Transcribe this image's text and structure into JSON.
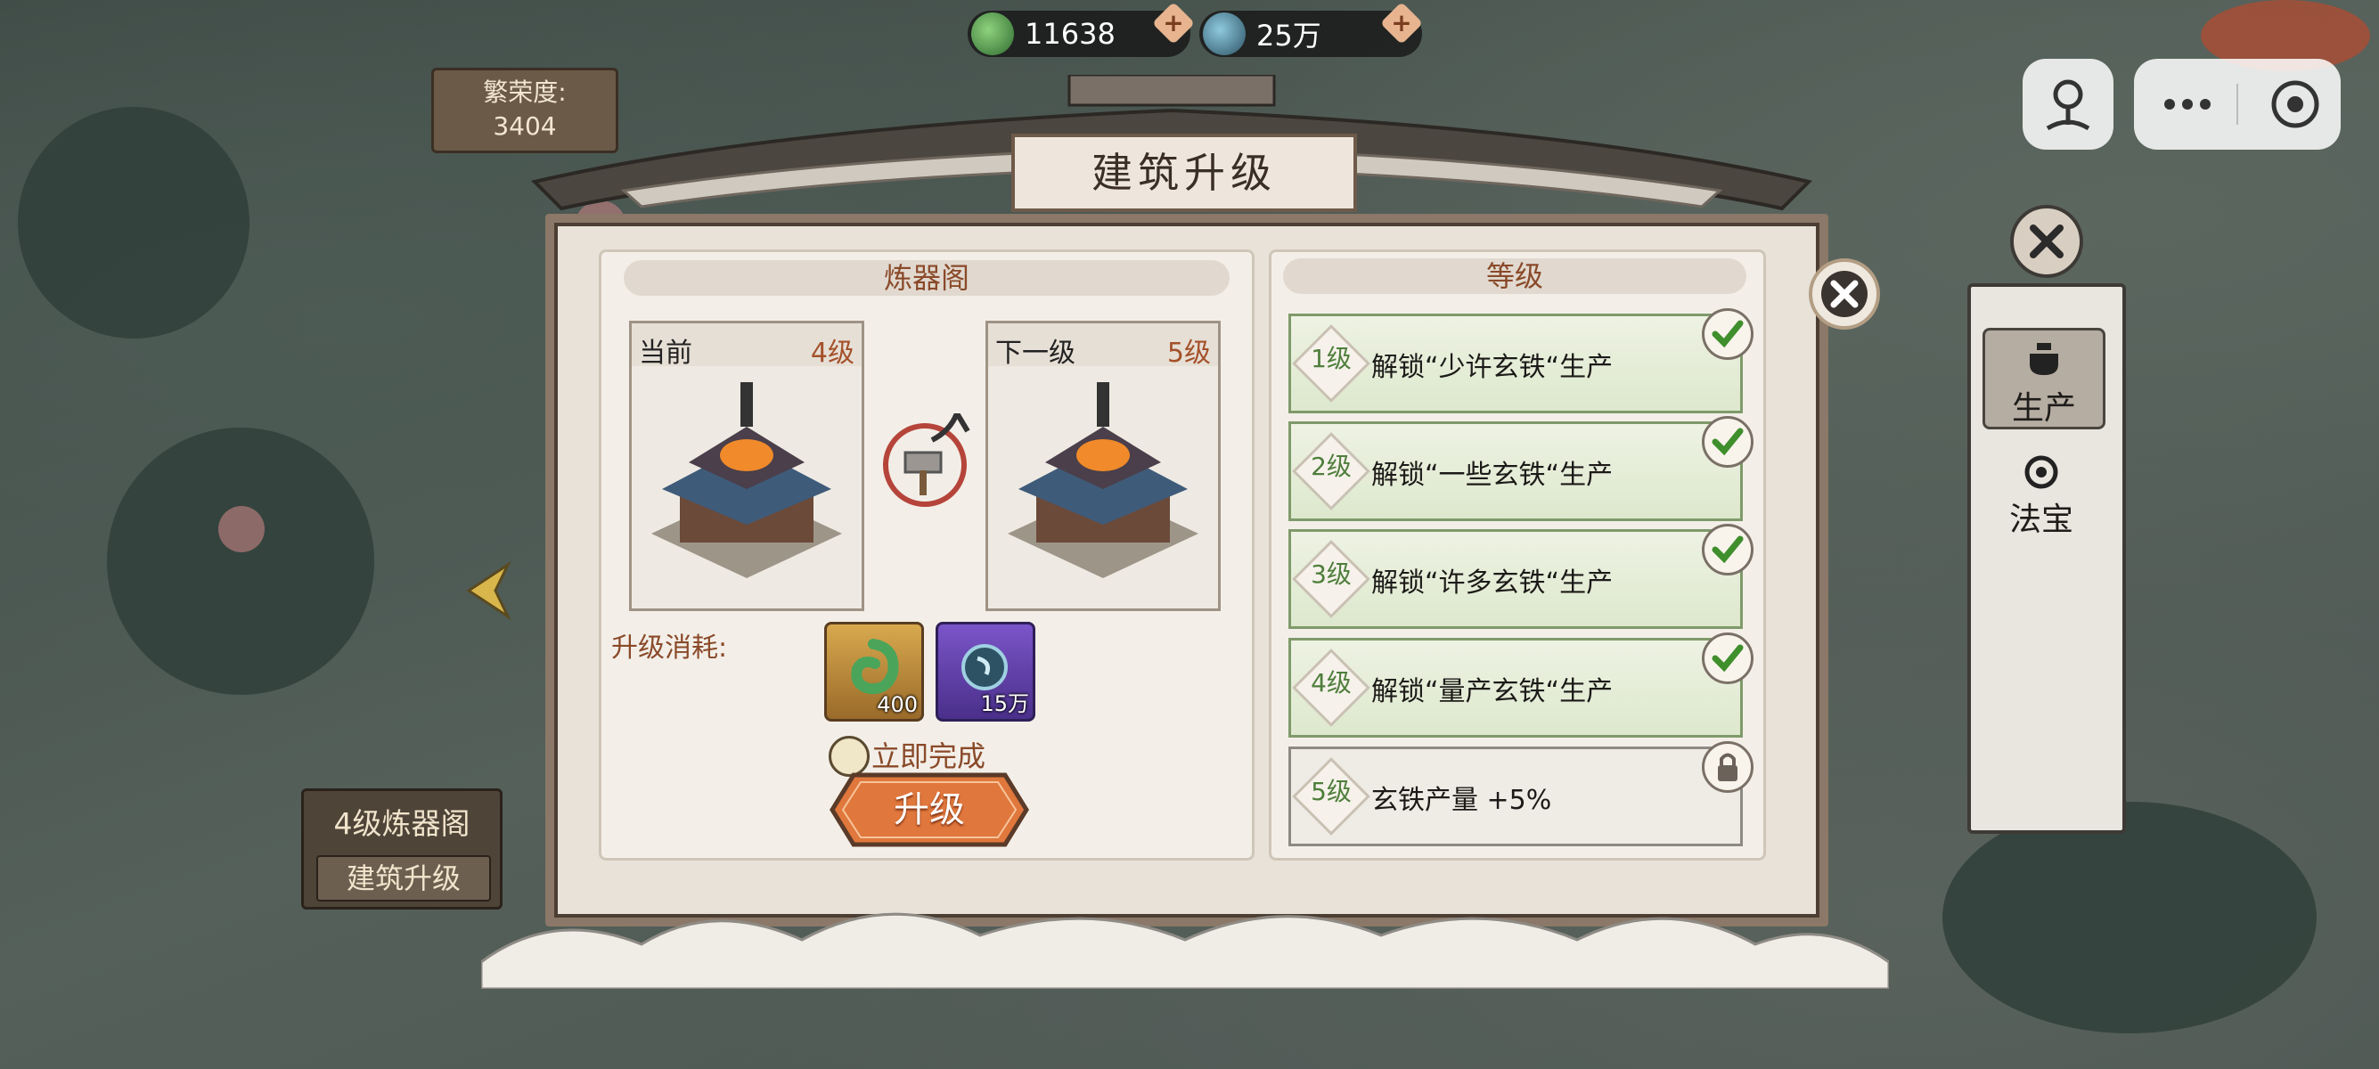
{
  "currency": {
    "jade": {
      "icon": "jade-icon",
      "amount": "11638"
    },
    "iron": {
      "icon": "iron-orb-icon",
      "amount": "25万"
    }
  },
  "prosperity": {
    "label": "繁荣度:",
    "value": "3404"
  },
  "left_panel": {
    "building": "4级炼器阁",
    "action": "建筑升级"
  },
  "side_tabs": {
    "production": "生产",
    "treasure": "法宝"
  },
  "dialog": {
    "title": "建筑升级",
    "building_name": "炼器阁",
    "current": {
      "label": "当前",
      "level": "4级"
    },
    "next": {
      "label": "下一级",
      "level": "5级"
    },
    "cost_label": "升级消耗:",
    "costs": [
      {
        "icon": "jade-icon",
        "amount": "400"
      },
      {
        "icon": "iron-orb-icon",
        "amount": "15万"
      }
    ],
    "instant_label": "立即完成",
    "upgrade_button": "升级",
    "levels_header": "等级",
    "levels": [
      {
        "level": "1级",
        "text": "解锁“少许玄铁“生产",
        "status": "unlocked"
      },
      {
        "level": "2级",
        "text": "解锁“一些玄铁“生产",
        "status": "unlocked"
      },
      {
        "level": "3级",
        "text": "解锁“许多玄铁“生产",
        "status": "unlocked"
      },
      {
        "level": "4级",
        "text": "解锁“量产玄铁“生产",
        "status": "unlocked"
      },
      {
        "level": "5级",
        "text": "玄铁产量 +5%",
        "status": "locked"
      }
    ]
  },
  "colors": {
    "accent": "#e0773c",
    "check": "#3f8f2c",
    "level_text": "#4f7e3c"
  }
}
